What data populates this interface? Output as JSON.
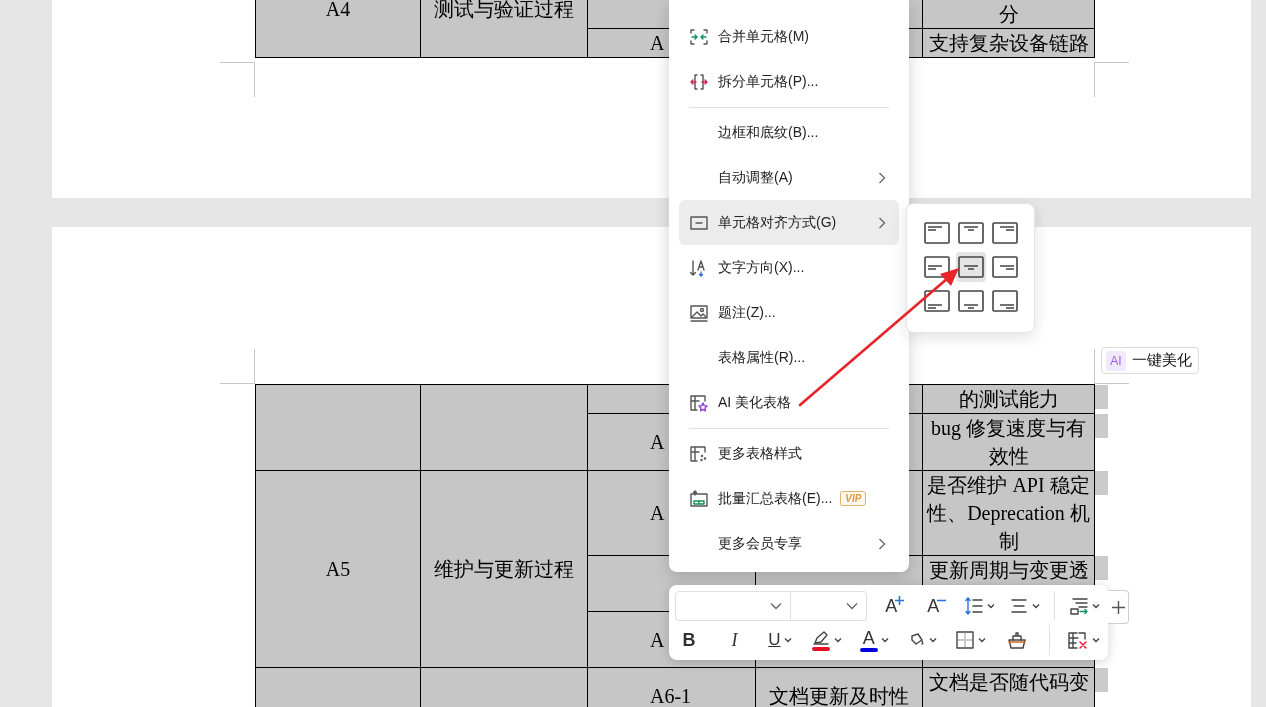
{
  "document": {
    "pages": [
      {
        "table": {
          "rows": [
            {
              "cells": [
                {
                  "text": "A4",
                  "rowspan": 2
                },
                {
                  "text": "测试与验证过程",
                  "rowspan": 2
                },
                {},
                {},
                {
                  "text": "分"
                }
              ],
              "end_mark": false
            },
            {
              "cells": [
                {
                  "text": "A"
                },
                {},
                {
                  "text": "支持复杂设备链路"
                }
              ],
              "end_mark": false
            }
          ]
        }
      },
      {
        "table": {
          "rows": [
            {
              "cells": [
                {
                  "rowspan": 2
                },
                {
                  "rowspan": 2
                },
                {},
                {},
                {
                  "text": "的测试能力"
                }
              ],
              "end_mark": true
            },
            {
              "cells": [
                {
                  "text": "A"
                },
                {},
                {
                  "text": "bug 修复速度与有效性"
                }
              ],
              "end_mark": true
            },
            {
              "cells": [
                {
                  "text": "A5",
                  "rowspan": 3
                },
                {
                  "text": "维护与更新过程",
                  "rowspan": 3
                },
                {
                  "text": "A"
                },
                {},
                {
                  "text": "是否维护 API 稳定性、Deprecation 机制"
                }
              ],
              "end_mark": true
            },
            {
              "cells": [
                {},
                {},
                {
                  "text": "更新周期与变更透"
                }
              ],
              "end_mark": true
            },
            {
              "cells": [
                {
                  "text": "A"
                },
                {},
                {}
              ],
              "end_mark": false
            },
            {
              "cells": [
                {},
                {},
                {
                  "text": "A6-1"
                },
                {
                  "text": "文档更新及时性"
                },
                {
                  "text": "文档是否随代码变"
                }
              ],
              "end_mark": true
            }
          ]
        }
      }
    ]
  },
  "context_menu": {
    "items": [
      {
        "kind": "item",
        "label": "合并单元格(M)",
        "submenu": false,
        "selected": false
      },
      {
        "kind": "item",
        "label": "拆分单元格(P)...",
        "submenu": false,
        "selected": false
      },
      {
        "kind": "separator"
      },
      {
        "kind": "item",
        "label": "边框和底纹(B)...",
        "submenu": false,
        "selected": false
      },
      {
        "kind": "item",
        "label": "自动调整(A)",
        "submenu": true,
        "selected": false
      },
      {
        "kind": "item",
        "label": "单元格对齐方式(G)",
        "submenu": true,
        "selected": true
      },
      {
        "kind": "item",
        "label": "文字方向(X)...",
        "submenu": false,
        "selected": false
      },
      {
        "kind": "item",
        "label": "题注(Z)...",
        "submenu": false,
        "selected": false
      },
      {
        "kind": "item",
        "label": "表格属性(R)...",
        "submenu": false,
        "selected": false
      },
      {
        "kind": "item",
        "label": "AI 美化表格",
        "submenu": false,
        "selected": false
      },
      {
        "kind": "separator"
      },
      {
        "kind": "item",
        "label": "更多表格样式",
        "submenu": false,
        "selected": false
      },
      {
        "kind": "item",
        "label": "批量汇总表格(E)...",
        "badge": "VIP",
        "submenu": false,
        "selected": false
      },
      {
        "kind": "item",
        "label": "更多会员专享",
        "submenu": true,
        "selected": false
      }
    ]
  },
  "align_menu": {
    "cells": [
      {
        "selected": false
      },
      {
        "selected": false
      },
      {
        "selected": false
      },
      {
        "selected": false
      },
      {
        "selected": true
      },
      {
        "selected": false
      },
      {
        "selected": false
      },
      {
        "selected": false
      },
      {
        "selected": false
      }
    ]
  },
  "toolbar": {
    "rows": [
      {
        "items": [
          {
            "kind": "font-combo"
          },
          {
            "kind": "size-combo"
          },
          {
            "kind": "grow-font",
            "glyph": "A"
          },
          {
            "kind": "shrink-font",
            "glyph": "A"
          },
          {
            "kind": "line-spacing",
            "menu": true
          },
          {
            "kind": "paragraph-align",
            "menu": true
          },
          {
            "kind": "divider"
          },
          {
            "kind": "text-wrap",
            "menu": true
          }
        ]
      },
      {
        "items": [
          {
            "kind": "bold",
            "glyph": "B"
          },
          {
            "kind": "italic",
            "glyph": "I"
          },
          {
            "kind": "underline",
            "glyph": "U",
            "menu": true
          },
          {
            "kind": "highlight",
            "color": "#e81123",
            "menu": true
          },
          {
            "kind": "font-color",
            "glyph": "A",
            "color": "#0000e0",
            "menu": true
          },
          {
            "kind": "fill",
            "menu": true
          },
          {
            "kind": "borders",
            "menu": true
          },
          {
            "kind": "clear-format"
          },
          {
            "kind": "divider"
          },
          {
            "kind": "delete-table",
            "menu": true
          }
        ]
      }
    ]
  },
  "ai_button": {
    "badge": "AI",
    "label": "一键美化"
  },
  "annotations": [
    {
      "kind": "arrow"
    }
  ]
}
